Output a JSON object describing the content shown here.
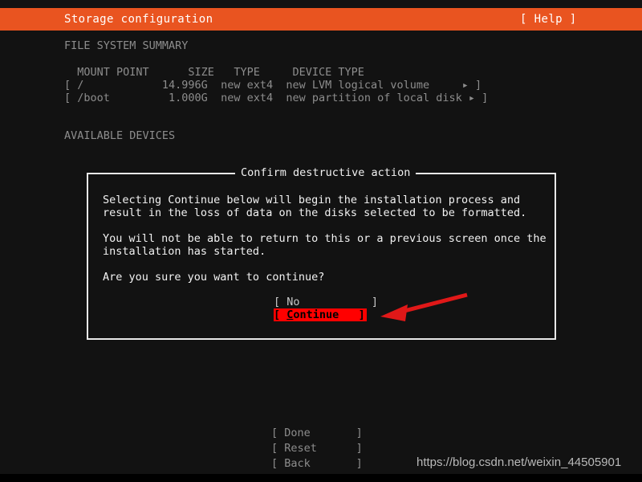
{
  "header": {
    "title": "Storage configuration",
    "help_label": "[ Help ]",
    "background_color": "#e95420",
    "text_color": "#ffffff"
  },
  "sections": {
    "filesystem_summary_heading": "FILE SYSTEM SUMMARY",
    "available_devices_heading": "AVAILABLE DEVICES"
  },
  "filesystem_table": {
    "header": "  MOUNT POINT      SIZE   TYPE     DEVICE TYPE",
    "rows": [
      "[ /            14.996G  new ext4  new LVM logical volume     ▸ ]",
      "[ /boot         1.000G  new ext4  new partition of local disk ▸ ]"
    ],
    "columns": [
      "MOUNT POINT",
      "SIZE",
      "TYPE",
      "DEVICE TYPE"
    ],
    "entries": [
      {
        "mount_point": "/",
        "size": "14.996G",
        "type": "new ext4",
        "device_type": "new LVM logical volume",
        "expander": "▸"
      },
      {
        "mount_point": "/boot",
        "size": "1.000G",
        "type": "new ext4",
        "device_type": "new partition of local disk",
        "expander": "▸"
      }
    ]
  },
  "dialog": {
    "title": "Confirm destructive action",
    "paragraphs": [
      [
        "Selecting Continue below will begin the installation process and",
        "result in the loss of data on the disks selected to be formatted."
      ],
      [
        "You will not be able to return to this or a previous screen once the",
        "installation has started."
      ],
      [
        "Are you sure you want to continue?"
      ]
    ],
    "buttons": [
      {
        "label": "[ No           ]",
        "selected": false,
        "name": "no"
      },
      {
        "label_prefix": "[ ",
        "label_cursor": "C",
        "label_rest": "ontinue   ]",
        "selected": true,
        "name": "continue"
      }
    ],
    "selected_button_bg": "#ff0000",
    "selected_button_fg": "#000000",
    "border_color": "#e8e8e8"
  },
  "annotation": {
    "arrow_color": "#e01818",
    "points_to": "continue-button"
  },
  "bottom_buttons": [
    "[ Done       ]",
    "[ Reset      ]",
    "[ Back       ]"
  ],
  "watermark": {
    "text": "https://blog.csdn.net/weixin_44505901"
  }
}
